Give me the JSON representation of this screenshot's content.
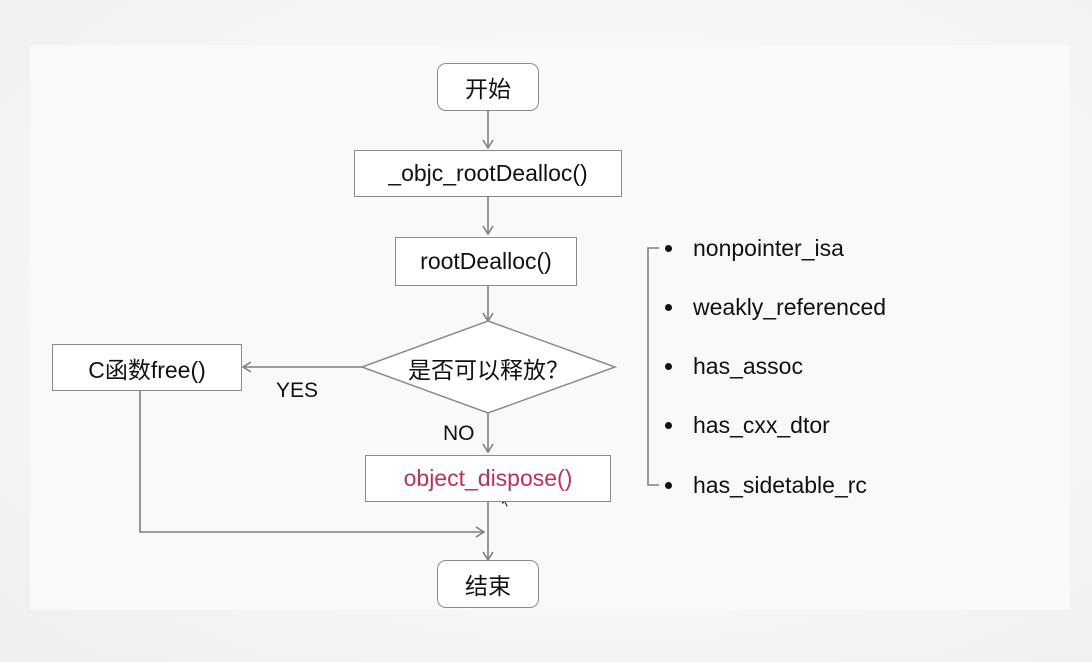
{
  "diagram": {
    "nodes": {
      "start": "开始",
      "objc_root_dealloc": "_objc_rootDealloc()",
      "root_dealloc": "rootDealloc()",
      "decision": "是否可以释放？",
      "c_free": "C函数free()",
      "object_dispose": "object_dispose()",
      "end": "结束"
    },
    "edge_labels": {
      "yes": "YES",
      "no": "NO"
    },
    "conditions": [
      "nonpointer_isa",
      "weakly_referenced",
      "has_assoc",
      "has_cxx_dtor",
      "has_sidetable_rc"
    ]
  },
  "colors": {
    "highlight_text": "#c0305a",
    "line": "#7f7f7f",
    "node_border": "#8a8a8a"
  }
}
